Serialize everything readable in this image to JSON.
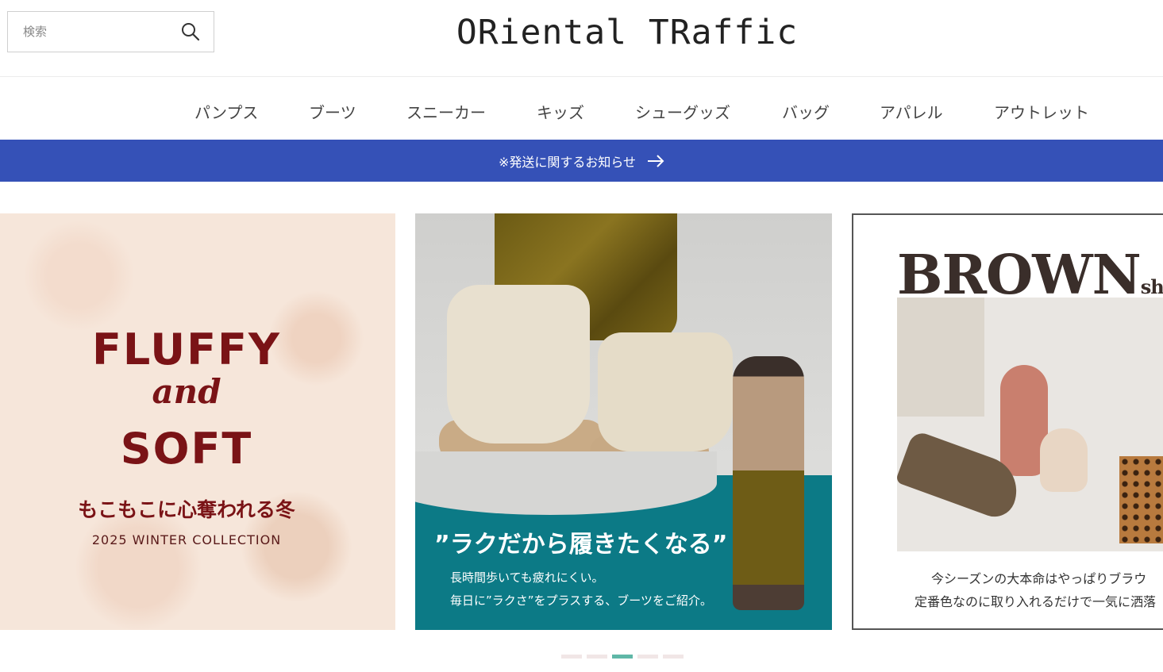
{
  "search": {
    "placeholder": "検索"
  },
  "logo": {
    "text": "ORiental TRaffic"
  },
  "nav": {
    "items": [
      {
        "label": "パンプス"
      },
      {
        "label": "ブーツ"
      },
      {
        "label": "スニーカー"
      },
      {
        "label": "キッズ"
      },
      {
        "label": "シューグッズ"
      },
      {
        "label": "バッグ"
      },
      {
        "label": "アパレル"
      },
      {
        "label": "アウトレット"
      }
    ]
  },
  "notice": {
    "label": "※発送に関するお知らせ"
  },
  "slides": [
    {
      "line1": "FLUFFY",
      "line2": "and",
      "line3": "SOFT",
      "subtitle": "もこもこに心奪われる冬",
      "collection": "2025 WINTER COLLECTION"
    },
    {
      "quote": "”ラクだから履きたくなる”",
      "line1": "長時間歩いても疲れにくい。",
      "line2": "毎日に”ラクさ”をプラスする、ブーツをご紹介。"
    },
    {
      "title": "BROWN",
      "title_suffix": "sh",
      "line1": "今シーズンの大本命はやっぱりブラウ",
      "line2": "定番色なのに取り入れるだけで一気に洒落"
    }
  ],
  "carousel": {
    "dot_count": 5,
    "active_index": 2
  },
  "colors": {
    "notice_bg": "#3551b7",
    "accent_dot": "#5fb7a7",
    "fluffy_text": "#7a1316",
    "teal": "#0c7a86"
  }
}
